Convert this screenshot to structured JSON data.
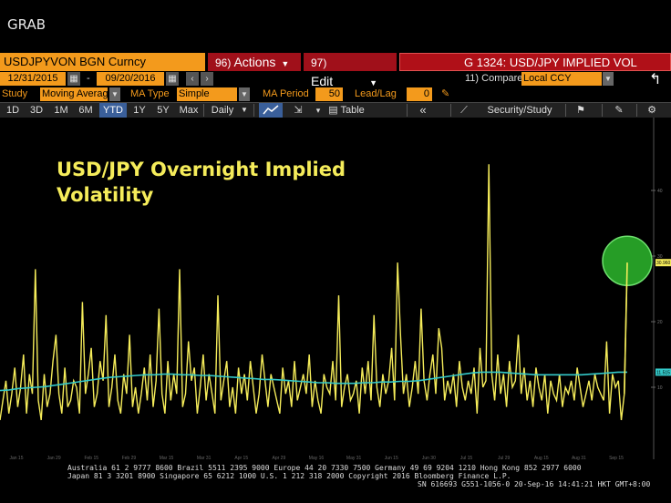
{
  "window": {
    "title": "GRAB"
  },
  "header": {
    "security": "USDJPYVON BGN Curncy",
    "actions_num": "96)",
    "actions_label": "Actions",
    "edit_num": "97)",
    "edit_label": "Edit",
    "graph_title": "G 1324: USD/JPY IMPLIED VOL"
  },
  "range": {
    "start": "12/31/2015",
    "sep": "-",
    "end": "09/20/2016",
    "compare_label": "11) Compare",
    "compare_value": "Local CCY"
  },
  "study": {
    "label": "Study",
    "value": "Moving Averag",
    "ma_type_label": "MA Type",
    "ma_type_value": "Simple",
    "ma_period_label": "MA Period",
    "ma_period_value": "50",
    "leadlag_label": "Lead/Lag",
    "leadlag_value": "0"
  },
  "toolbar": {
    "periods": [
      "1D",
      "3D",
      "1M",
      "6M",
      "YTD",
      "1Y",
      "5Y",
      "Max"
    ],
    "active_period": "YTD",
    "frequency": "Daily",
    "table_label": "Table",
    "security_study_label": "Security/Study"
  },
  "chart_data": {
    "type": "line",
    "title": "USD/JPY Overnight Implied Volatility",
    "colors": {
      "series": "#f5ec5a",
      "moving_average": "#33c8c8",
      "highlight": "#2db82d",
      "title": "#f5ec5a"
    },
    "x_ticks": [
      "Jan 15",
      "Jan 29",
      "Feb 15",
      "Feb 29",
      "Mar 15",
      "Mar 31",
      "Apr 15",
      "Apr 29",
      "May 16",
      "May 31",
      "Jun 15",
      "Jun 30",
      "Jul 15",
      "Jul 29",
      "Aug 15",
      "Aug 31",
      "Sep 15"
    ],
    "ylim": [
      0,
      50
    ],
    "y_ticks": [
      10,
      20,
      30,
      40
    ],
    "series": [
      {
        "name": "USDJPYVON",
        "values": [
          5,
          8,
          11,
          6,
          9,
          13,
          7,
          10,
          15,
          6,
          12,
          9,
          28,
          8,
          5,
          12,
          7,
          9,
          14,
          18,
          9,
          6,
          13,
          7,
          8,
          11,
          10,
          6,
          23,
          9,
          12,
          16,
          7,
          9,
          14,
          11,
          21,
          7,
          10,
          15,
          8,
          6,
          12,
          9,
          18,
          7,
          10,
          6,
          9,
          13,
          8,
          15,
          7,
          11,
          22,
          9,
          6,
          14,
          8,
          12,
          9,
          28,
          7,
          9,
          17,
          11,
          13,
          6,
          10,
          15,
          8,
          12,
          9,
          6,
          24,
          8,
          11,
          14,
          7,
          10,
          6,
          13,
          9,
          12,
          8,
          14,
          10,
          6,
          9,
          15,
          11,
          7,
          12,
          10,
          8,
          6,
          13,
          9,
          11,
          7,
          14,
          8,
          10,
          12,
          9,
          15,
          7,
          11,
          8,
          6,
          12,
          10,
          9,
          14,
          8,
          24,
          7,
          10,
          12,
          8,
          9,
          11,
          6,
          13,
          9,
          14,
          8,
          21,
          10,
          7,
          12,
          9,
          11,
          16,
          8,
          29,
          18,
          9,
          12,
          7,
          10,
          14,
          9,
          22,
          11,
          8,
          12,
          15,
          9,
          19,
          16,
          8,
          11,
          9,
          12,
          7,
          14,
          10,
          8,
          11,
          9,
          13,
          6,
          16,
          10,
          11,
          44,
          12,
          8,
          15,
          9,
          12,
          7,
          14,
          10,
          11,
          18,
          9,
          13,
          8,
          11,
          7,
          13,
          10,
          8,
          12,
          6,
          11,
          9,
          8,
          12,
          7,
          10,
          9,
          11,
          8,
          13,
          10,
          7,
          9,
          11,
          8,
          12,
          10,
          9,
          8,
          17,
          6,
          12,
          10,
          11,
          5,
          9,
          29
        ],
        "latest": "30.960"
      },
      {
        "name": "Simple MA 50",
        "values": [
          9.5,
          9.6,
          9.8,
          9.9,
          10.0,
          10.1,
          10.3,
          10.5,
          10.7,
          10.9,
          11.1,
          11.3,
          11.5,
          11.6,
          11.7,
          11.8,
          11.9,
          11.9,
          12.0,
          12.0,
          11.9,
          11.9,
          11.8,
          11.8,
          11.7,
          11.6,
          11.5,
          11.4,
          11.3,
          11.2,
          11.2,
          11.1,
          11.0,
          10.9,
          10.8,
          10.7,
          10.7,
          10.6,
          10.6,
          10.6,
          10.7,
          10.7,
          10.8,
          10.8,
          10.9,
          10.9,
          11.0,
          11.2,
          11.4,
          11.6,
          11.8,
          12.0,
          12.2,
          12.3,
          12.3,
          12.3,
          12.2,
          12.1,
          12.0,
          11.9,
          11.9,
          11.9,
          11.9,
          11.9,
          11.9,
          12.0,
          12.1,
          12.2,
          12.3,
          12.3
        ],
        "latest": "11.515"
      }
    ]
  },
  "footer": {
    "line1": "Australia 61 2 9777 8600 Brazil 5511 2395 9000 Europe 44 20 7330 7500 Germany 49 69 9204 1210 Hong Kong 852 2977 6000",
    "line2": "Japan 81 3 3201 8900     Singapore 65 6212 1000     U.S. 1 212 318 2000            Copyright 2016 Bloomberg Finance L.P.",
    "line3": "SN 616693 G551-1056-0 20-Sep-16 14:41:21 HKT  GMT+8:00"
  }
}
